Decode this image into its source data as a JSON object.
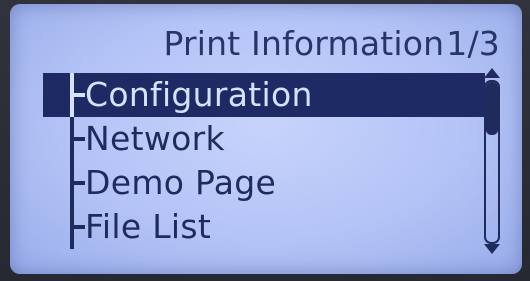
{
  "screen": {
    "title": "Print Information",
    "page_indicator": "1/3"
  },
  "menu": {
    "items": [
      {
        "label": "Configuration",
        "selected": true
      },
      {
        "label": "Network",
        "selected": false
      },
      {
        "label": "Demo Page",
        "selected": false
      },
      {
        "label": "File List",
        "selected": false
      }
    ]
  },
  "scrollbar": {
    "position_fraction": 0.0,
    "visible_fraction": 0.33
  },
  "colors": {
    "lcd_background": "#b3c3f6",
    "text": "#1f2b5c",
    "highlight_background": "#1d2a63",
    "highlight_text": "#d6e0ff"
  }
}
